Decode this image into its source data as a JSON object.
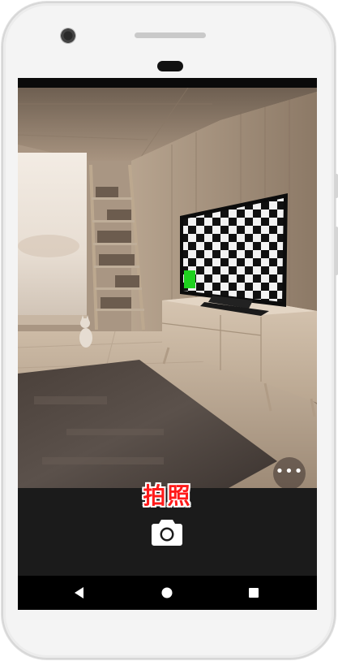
{
  "device": {
    "frame_color": "#f4f4f4",
    "icons": [
      "front-camera-icon",
      "earpiece-speaker-icon",
      "proximity-sensor-icon"
    ]
  },
  "camera": {
    "caption": "拍照",
    "caption_color": "#ff1a1a",
    "shutter_icon": "camera-icon",
    "more_options_icon": "more-horizontal-icon",
    "more_options_glyph": "•••",
    "highlight_color": "#1fd11f"
  },
  "navbar": {
    "back_icon": "back-triangle-icon",
    "home_icon": "home-circle-icon",
    "recents_icon": "recents-square-icon"
  }
}
